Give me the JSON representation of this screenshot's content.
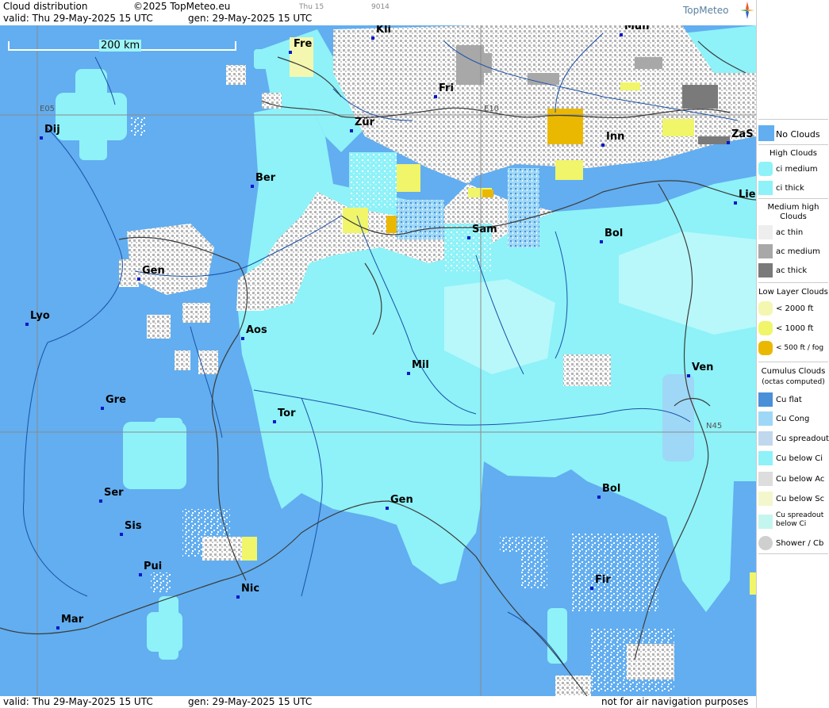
{
  "header": {
    "title": "Cloud distribution",
    "copyright": "©2025 TopMeteo.eu",
    "valid_line": "valid:  Thu  29-May-2025  15 UTC",
    "gen_line": "gen: 29-May-2025 15 UTC",
    "small1": "Thu 15",
    "small2": "9014",
    "brand": "TopMeteo"
  },
  "scale": {
    "label": "200 km"
  },
  "grid": {
    "e05": "E05",
    "e10": "E10",
    "n45": "N45"
  },
  "cities": [
    {
      "name": "Kli"
    },
    {
      "name": "Mun"
    },
    {
      "name": "Fre"
    },
    {
      "name": "Fri"
    },
    {
      "name": "Dij"
    },
    {
      "name": "Zür"
    },
    {
      "name": "Inn"
    },
    {
      "name": "ZaS"
    },
    {
      "name": "Ber"
    },
    {
      "name": "Lie"
    },
    {
      "name": "Sam"
    },
    {
      "name": "Bol"
    },
    {
      "name": "Gen"
    },
    {
      "name": "Lyo"
    },
    {
      "name": "Aos"
    },
    {
      "name": "Mil"
    },
    {
      "name": "Ven"
    },
    {
      "name": "Gre"
    },
    {
      "name": "Tor"
    },
    {
      "name": "Ser"
    },
    {
      "name": "Gen"
    },
    {
      "name": "Bol"
    },
    {
      "name": "Sis"
    },
    {
      "name": "Pui"
    },
    {
      "name": "Nic"
    },
    {
      "name": "Fir"
    },
    {
      "name": "Mar"
    }
  ],
  "footer": {
    "valid_line": "valid:  Thu  29-May-2025  15 UTC",
    "gen_line": "gen: 29-May-2025 15 UTC",
    "notice": "not for air navigation purposes"
  },
  "legend": {
    "no_clouds": "No Clouds",
    "high_title": "High Clouds",
    "ci_medium": "ci medium",
    "ci_thick": "ci thick",
    "medium_title": "Medium high Clouds",
    "ac_thin": "ac thin",
    "ac_medium": "ac medium",
    "ac_thick": "ac thick",
    "low_title": "Low Layer Clouds",
    "low1": "< 2000 ft",
    "low2": "< 1000 ft",
    "low3": "< 500 ft / fog",
    "cu_title": "Cumulus Clouds",
    "cu_sub": "(octas computed)",
    "cu_flat": "Cu flat",
    "cu_cong": "Cu Cong",
    "cu_spread": "Cu spreadout",
    "cu_ci": "Cu below Ci",
    "cu_ac": "Cu below Ac",
    "cu_sc": "Cu below Sc",
    "cu_spread_ci": "Cu spreadout below Ci",
    "shower": "Shower / Cb"
  },
  "colors": {
    "no_clouds": "#62aef0",
    "ci": "#8ef2f8",
    "ac_thin": "#eeeeee",
    "ac_medium": "#a8a8a8",
    "ac_thick": "#7a7a7a",
    "low1": "#f4f7b0",
    "low2": "#f0f56a",
    "low3": "#eab800"
  }
}
